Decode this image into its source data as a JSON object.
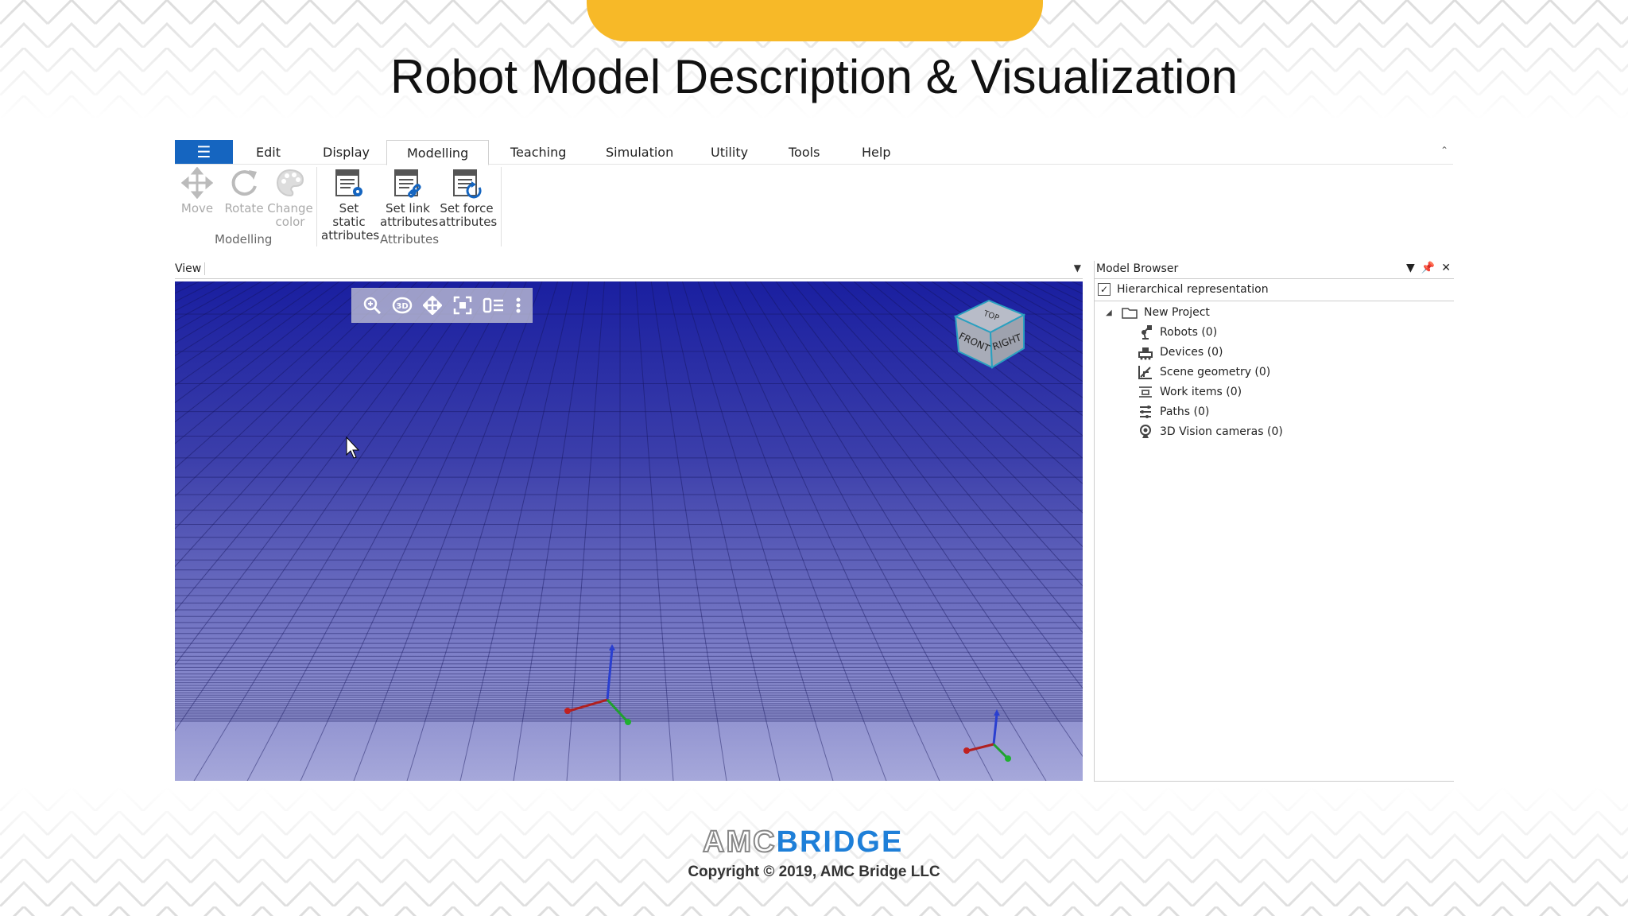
{
  "slide": {
    "title": "Robot Model Description & Visualization",
    "copyright": "Copyright © 2019, AMC Bridge LLC",
    "logo_left": "AMC",
    "logo_right": "BRIDGE",
    "accent_color": "#f7b928"
  },
  "menu": {
    "file_icon": "hamburger-icon",
    "items": [
      "Edit",
      "Display",
      "Modelling",
      "Teaching",
      "Simulation",
      "Utility",
      "Tools",
      "Help"
    ],
    "active": "Modelling"
  },
  "ribbon": {
    "modelling_group": {
      "label": "Modelling",
      "buttons": [
        {
          "line1": "Move",
          "line2": "",
          "icon": "move-icon",
          "enabled": false
        },
        {
          "line1": "Rotate",
          "line2": "",
          "icon": "rotate-icon",
          "enabled": false
        },
        {
          "line1": "Change",
          "line2": "color",
          "icon": "palette-icon",
          "enabled": false
        }
      ]
    },
    "attributes_group": {
      "label": "Attributes",
      "buttons": [
        {
          "line1": "Set static",
          "line2": "attributes",
          "icon": "static-attributes-icon",
          "enabled": true
        },
        {
          "line1": "Set link",
          "line2": "attributes",
          "icon": "link-attributes-icon",
          "enabled": true
        },
        {
          "line1": "Set force",
          "line2": "attributes",
          "icon": "force-attributes-icon",
          "enabled": true
        }
      ]
    }
  },
  "view": {
    "label": "View",
    "toolbar_icons": [
      "zoom-icon",
      "3d-rotate-icon",
      "pan-icon",
      "fit-view-icon",
      "display-options-icon",
      "more-icon"
    ],
    "cube_faces": {
      "top": "TOP",
      "front": "FRONT",
      "right": "RIGHT"
    }
  },
  "browser": {
    "title": "Model Browser",
    "hierarchical_label": "Hierarchical representation",
    "hierarchical_checked": true,
    "root": "New Project",
    "items": [
      {
        "label": "Robots (0)",
        "icon": "robot-icon"
      },
      {
        "label": "Devices (0)",
        "icon": "device-icon"
      },
      {
        "label": "Scene geometry (0)",
        "icon": "scene-geometry-icon"
      },
      {
        "label": "Work items (0)",
        "icon": "work-items-icon"
      },
      {
        "label": "Paths (0)",
        "icon": "paths-icon"
      },
      {
        "label": "3D Vision cameras (0)",
        "icon": "camera-icon"
      }
    ]
  }
}
